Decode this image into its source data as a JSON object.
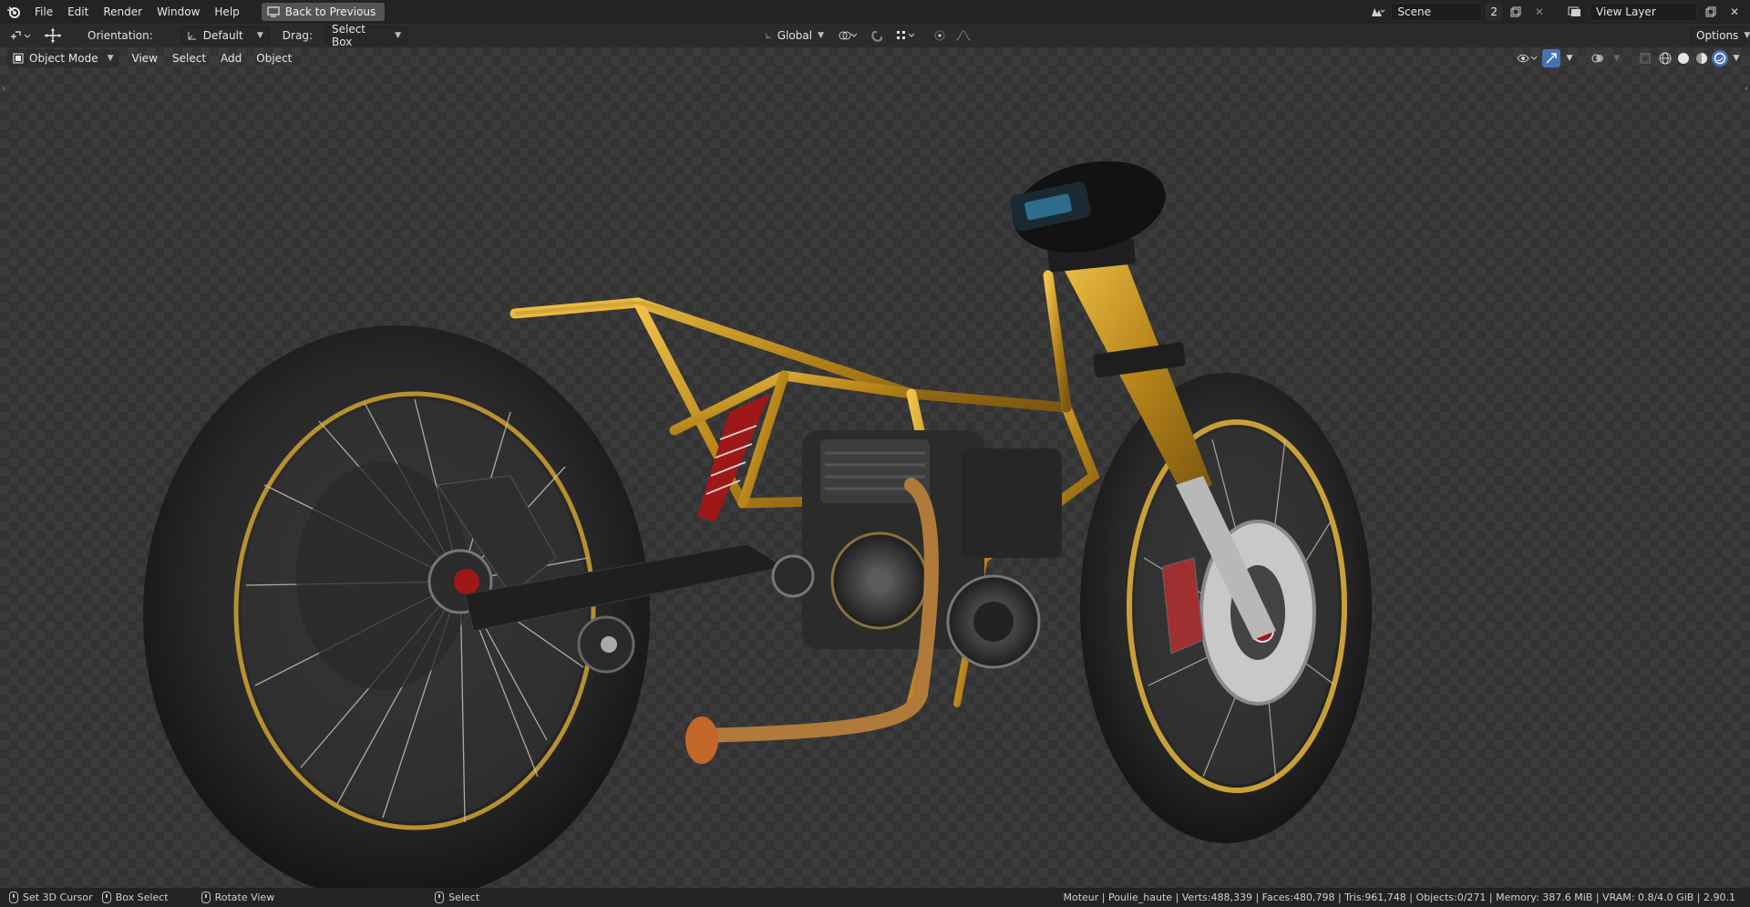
{
  "menubar": {
    "items": [
      "File",
      "Edit",
      "Render",
      "Window",
      "Help"
    ],
    "back_button": "Back to Previous"
  },
  "scene": {
    "name": "Scene",
    "users": "2"
  },
  "view_layer": {
    "name": "View Layer"
  },
  "tool_header": {
    "orientation_label": "Orientation:",
    "orientation_value": "Default",
    "drag_label": "Drag:",
    "drag_value": "Select Box",
    "transform_space": "Global",
    "options_label": "Options"
  },
  "viewport_header": {
    "mode": "Object Mode",
    "menus": [
      "View",
      "Select",
      "Add",
      "Object"
    ]
  },
  "statusbar": {
    "hints": [
      "Set 3D Cursor",
      "Box Select",
      "Rotate View",
      "Select"
    ],
    "stats": "Moteur | Poulie_haute | Verts:488,339 | Faces:480,798 | Tris:961,748 | Objects:0/271 | Memory: 387.6 MiB | VRAM: 0.8/4.0 GiB | 2.90.1"
  },
  "colors": {
    "frame_gold": "#c8961e",
    "tire": "#262626",
    "brake_accent": "#9e1818",
    "active_shading": "#4772b3"
  }
}
